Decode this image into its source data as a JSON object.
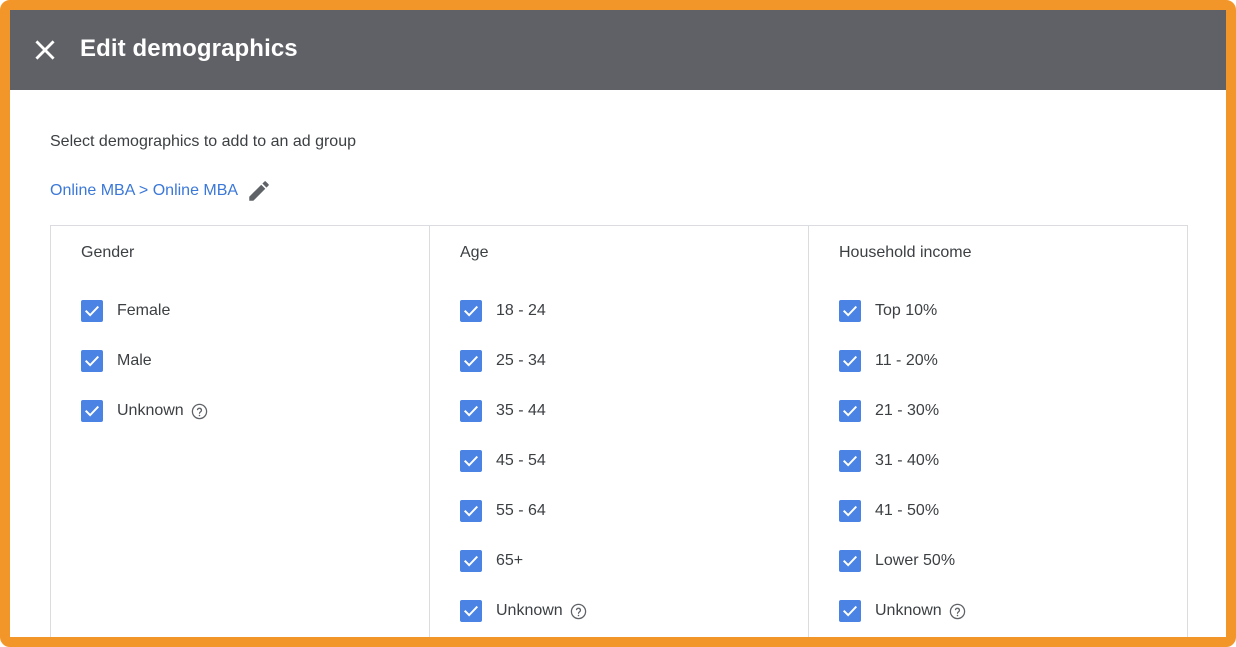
{
  "dialog": {
    "title": "Edit demographics",
    "subtitle": "Select demographics to add to an ad group",
    "breadcrumb": "Online MBA > Online MBA"
  },
  "colors": {
    "accent_border": "#f2962a",
    "header_bg": "#606166",
    "checkbox": "#4a83e4",
    "link": "#3b78d8"
  },
  "icons": {
    "close": "close-icon",
    "edit": "pencil-icon",
    "help": "help-circle-icon",
    "check": "checkmark-icon"
  },
  "columns": [
    {
      "title": "Gender",
      "options": [
        {
          "label": "Female",
          "checked": true,
          "help": false
        },
        {
          "label": "Male",
          "checked": true,
          "help": false
        },
        {
          "label": "Unknown",
          "checked": true,
          "help": true
        }
      ]
    },
    {
      "title": "Age",
      "options": [
        {
          "label": "18 - 24",
          "checked": true,
          "help": false
        },
        {
          "label": "25 - 34",
          "checked": true,
          "help": false
        },
        {
          "label": "35 - 44",
          "checked": true,
          "help": false
        },
        {
          "label": "45 - 54",
          "checked": true,
          "help": false
        },
        {
          "label": "55 - 64",
          "checked": true,
          "help": false
        },
        {
          "label": "65+",
          "checked": true,
          "help": false
        },
        {
          "label": "Unknown",
          "checked": true,
          "help": true
        }
      ]
    },
    {
      "title": "Household income",
      "options": [
        {
          "label": "Top 10%",
          "checked": true,
          "help": false
        },
        {
          "label": "11 - 20%",
          "checked": true,
          "help": false
        },
        {
          "label": "21 - 30%",
          "checked": true,
          "help": false
        },
        {
          "label": "31 - 40%",
          "checked": true,
          "help": false
        },
        {
          "label": "41 - 50%",
          "checked": true,
          "help": false
        },
        {
          "label": "Lower 50%",
          "checked": true,
          "help": false
        },
        {
          "label": "Unknown",
          "checked": true,
          "help": true
        }
      ]
    }
  ]
}
